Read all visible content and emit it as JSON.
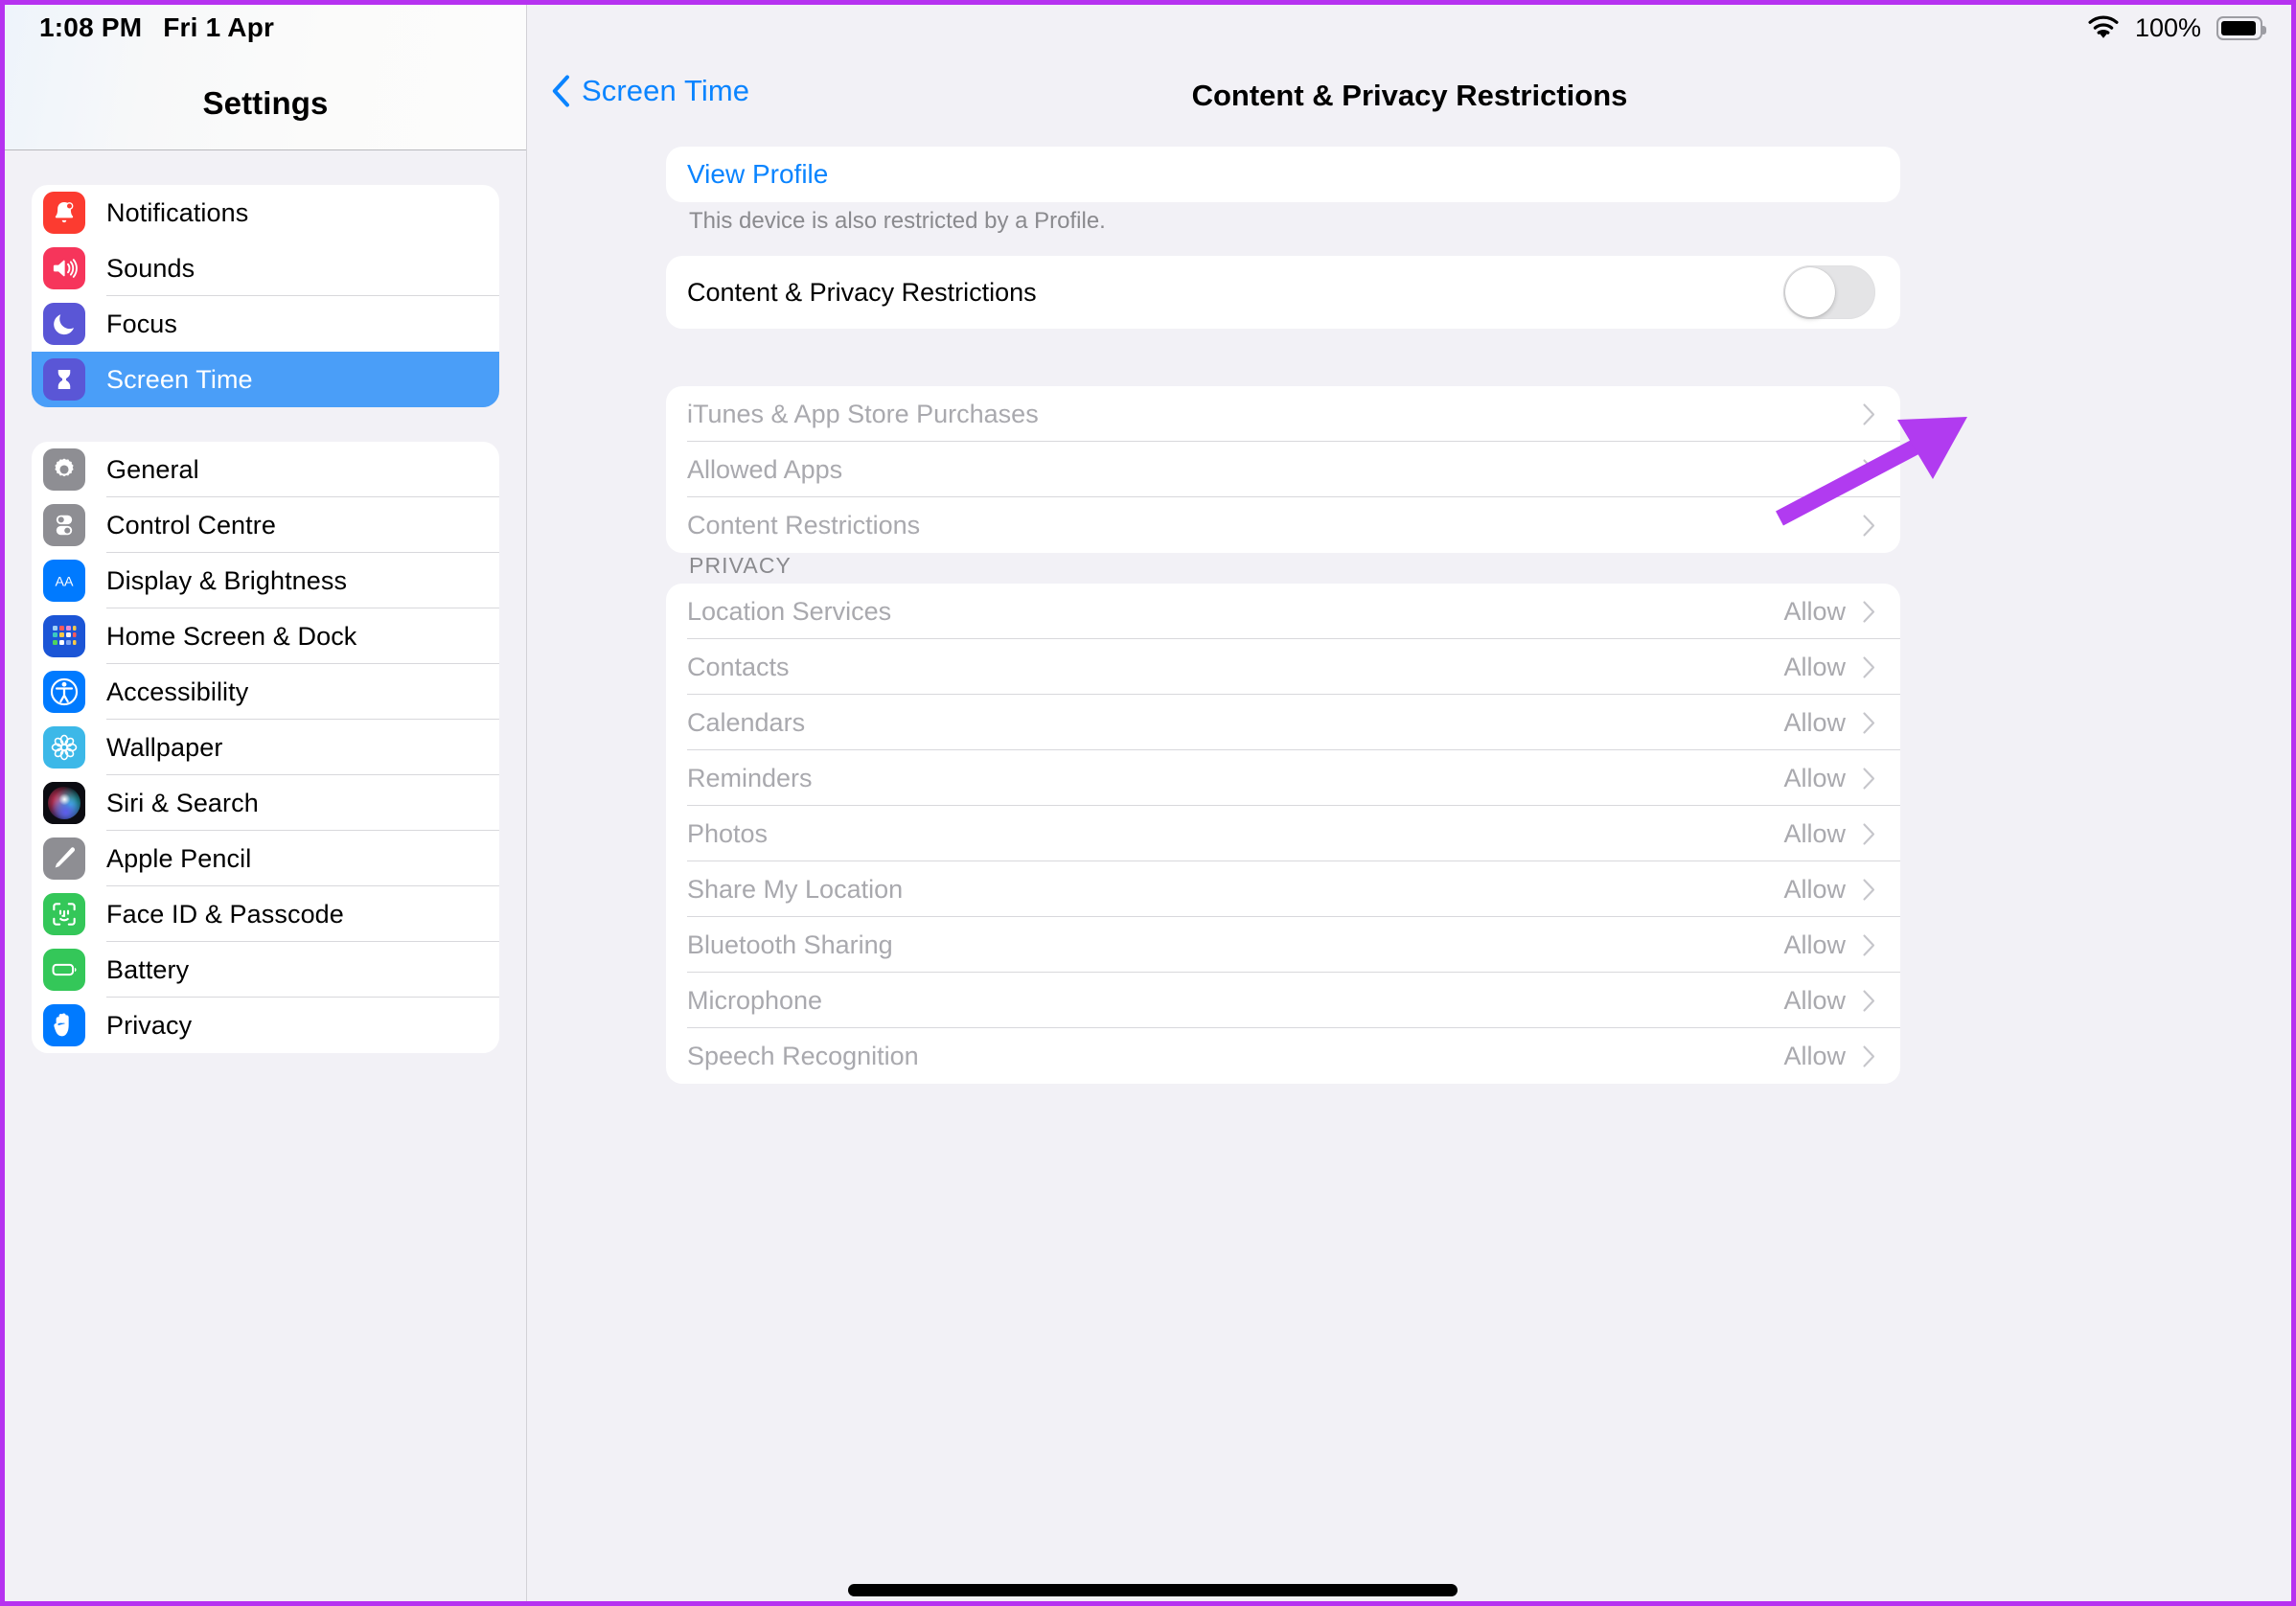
{
  "status_bar": {
    "time": "1:08 PM",
    "date": "Fri 1 Apr",
    "battery_percent": "100%",
    "wifi_icon": "wifi-icon",
    "battery_icon": "battery-full-icon"
  },
  "sidebar": {
    "title": "Settings",
    "groups": [
      {
        "items": [
          {
            "label": "Notifications",
            "icon": "bell-icon",
            "selected": false
          },
          {
            "label": "Sounds",
            "icon": "speaker-waves-icon",
            "selected": false
          },
          {
            "label": "Focus",
            "icon": "moon-icon",
            "selected": false
          },
          {
            "label": "Screen Time",
            "icon": "hourglass-icon",
            "selected": true
          }
        ]
      },
      {
        "items": [
          {
            "label": "General",
            "icon": "gear-icon",
            "selected": false
          },
          {
            "label": "Control Centre",
            "icon": "sliders-icon",
            "selected": false
          },
          {
            "label": "Display & Brightness",
            "icon": "aa-text-icon",
            "selected": false
          },
          {
            "label": "Home Screen & Dock",
            "icon": "app-grid-icon",
            "selected": false
          },
          {
            "label": "Accessibility",
            "icon": "accessibility-icon",
            "selected": false
          },
          {
            "label": "Wallpaper",
            "icon": "flower-icon",
            "selected": false
          },
          {
            "label": "Siri & Search",
            "icon": "siri-orb-icon",
            "selected": false
          },
          {
            "label": "Apple Pencil",
            "icon": "pencil-icon",
            "selected": false
          },
          {
            "label": "Face ID & Passcode",
            "icon": "face-id-icon",
            "selected": false
          },
          {
            "label": "Battery",
            "icon": "battery-icon",
            "selected": false
          },
          {
            "label": "Privacy",
            "icon": "hand-icon",
            "selected": false
          }
        ]
      }
    ]
  },
  "detail": {
    "back_label": "Screen Time",
    "back_icon": "chevron-left-icon",
    "title": "Content & Privacy Restrictions",
    "profile_link": "View Profile",
    "profile_note": "This device is also restricted by a Profile.",
    "master_toggle": {
      "label": "Content & Privacy Restrictions",
      "state": "off"
    },
    "restriction_rows": [
      {
        "label": "iTunes & App Store Purchases",
        "disabled": true,
        "chevron": "chevron-right-icon"
      },
      {
        "label": "Allowed Apps",
        "disabled": true,
        "chevron": "chevron-right-icon"
      },
      {
        "label": "Content Restrictions",
        "disabled": true,
        "chevron": "chevron-right-icon"
      }
    ],
    "privacy_header": "PRIVACY",
    "privacy_rows": [
      {
        "label": "Location Services",
        "value": "Allow",
        "chevron": "chevron-right-icon"
      },
      {
        "label": "Contacts",
        "value": "Allow",
        "chevron": "chevron-right-icon"
      },
      {
        "label": "Calendars",
        "value": "Allow",
        "chevron": "chevron-right-icon"
      },
      {
        "label": "Reminders",
        "value": "Allow",
        "chevron": "chevron-right-icon"
      },
      {
        "label": "Photos",
        "value": "Allow",
        "chevron": "chevron-right-icon"
      },
      {
        "label": "Share My Location",
        "value": "Allow",
        "chevron": "chevron-right-icon"
      },
      {
        "label": "Bluetooth Sharing",
        "value": "Allow",
        "chevron": "chevron-right-icon"
      },
      {
        "label": "Microphone",
        "value": "Allow",
        "chevron": "chevron-right-icon"
      },
      {
        "label": "Speech Recognition",
        "value": "Allow",
        "chevron": "chevron-right-icon"
      }
    ]
  },
  "annotation": {
    "arrow_color": "#b13bf0",
    "points_at": "content-privacy-restrictions-toggle"
  },
  "colors": {
    "accent_blue": "#0a84ff",
    "selected_row_blue": "#4a9ef8",
    "page_background": "#f2f1f6",
    "card_background": "#ffffff",
    "dim_text": "#a9a9ae",
    "border_highlight": "#b632f0"
  }
}
